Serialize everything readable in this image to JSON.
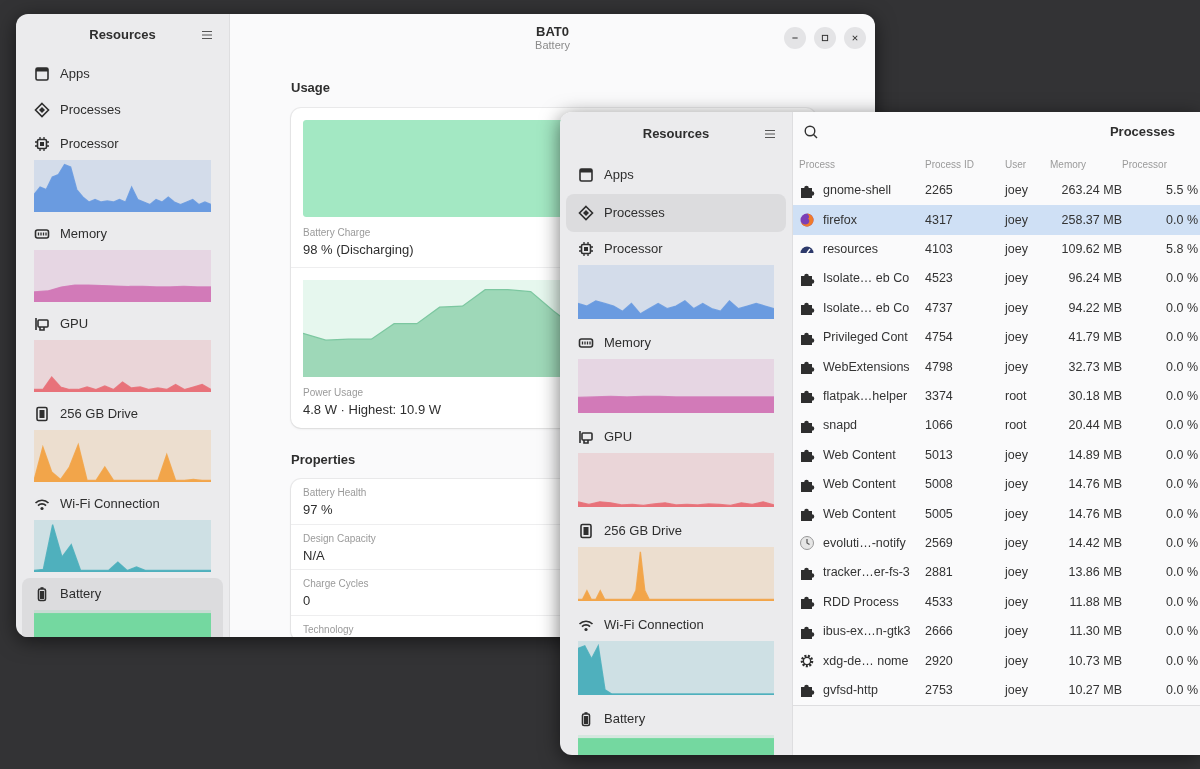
{
  "battery_window": {
    "title": "BAT0",
    "subtitle": "Battery",
    "sidebar": {
      "title": "Resources",
      "items": [
        {
          "label": "Apps",
          "kind": "link",
          "selected": false
        },
        {
          "label": "Processes",
          "kind": "link",
          "selected": false
        },
        {
          "label": "Processor",
          "kind": "graph",
          "selected": false,
          "color": "#6a9be0"
        },
        {
          "label": "Memory",
          "kind": "graph",
          "selected": false,
          "color": "#d27ab8"
        },
        {
          "label": "GPU",
          "kind": "graph",
          "selected": false,
          "color": "#e8727a"
        },
        {
          "label": "256 GB Drive",
          "kind": "graph",
          "selected": false,
          "color": "#f2a54a"
        },
        {
          "label": "Wi-Fi Connection",
          "kind": "graph",
          "selected": false,
          "color": "#4fb0bd"
        },
        {
          "label": "Battery",
          "kind": "graph",
          "selected": true,
          "color": "#74d8a0"
        }
      ]
    },
    "usage": {
      "heading": "Usage",
      "charge": {
        "label": "Battery Charge",
        "value": "98 % (Discharging)",
        "level": 0.98
      },
      "power": {
        "label": "Power Usage",
        "value": "4.8 W · Highest: 10.9 W"
      }
    },
    "properties": {
      "heading": "Properties",
      "rows": [
        {
          "label": "Battery Health",
          "value": "97 %"
        },
        {
          "label": "Design Capacity",
          "value": "N/A"
        },
        {
          "label": "Charge Cycles",
          "value": "0"
        },
        {
          "label": "Technology"
        }
      ]
    }
  },
  "processes_window": {
    "title": "Processes",
    "sidebar": {
      "title": "Resources",
      "items": [
        {
          "label": "Apps",
          "kind": "link",
          "selected": false
        },
        {
          "label": "Processes",
          "kind": "link",
          "selected": true
        },
        {
          "label": "Processor",
          "kind": "graph",
          "selected": false,
          "color": "#6a9be0"
        },
        {
          "label": "Memory",
          "kind": "graph",
          "selected": false,
          "color": "#d27ab8"
        },
        {
          "label": "GPU",
          "kind": "graph",
          "selected": false,
          "color": "#e8727a"
        },
        {
          "label": "256 GB Drive",
          "kind": "graph",
          "selected": false,
          "color": "#f2a54a"
        },
        {
          "label": "Wi-Fi Connection",
          "kind": "graph",
          "selected": false,
          "color": "#4fb0bd"
        },
        {
          "label": "Battery",
          "kind": "graph",
          "selected": false,
          "color": "#74d8a0"
        }
      ]
    },
    "table": {
      "columns": [
        "Process",
        "Process ID",
        "User",
        "Memory",
        "Processor"
      ],
      "rows": [
        {
          "cells": [
            "gnome-shell",
            "2265",
            "joey",
            "263.24 MB",
            "5.5 %"
          ],
          "selected": false
        },
        {
          "cells": [
            "firefox",
            "4317",
            "joey",
            "258.37 MB",
            "0.0 %"
          ],
          "selected": true
        },
        {
          "cells": [
            "resources",
            "4103",
            "joey",
            "109.62 MB",
            "5.8 %"
          ],
          "selected": false
        },
        {
          "cells": [
            "Isolate… eb Co",
            "4523",
            "joey",
            "96.24 MB",
            "0.0 %"
          ],
          "selected": false
        },
        {
          "cells": [
            "Isolate… eb Co",
            "4737",
            "joey",
            "94.22 MB",
            "0.0 %"
          ],
          "selected": false
        },
        {
          "cells": [
            "Privileged Cont",
            "4754",
            "joey",
            "41.79 MB",
            "0.0 %"
          ],
          "selected": false
        },
        {
          "cells": [
            "WebExtensions",
            "4798",
            "joey",
            "32.73 MB",
            "0.0 %"
          ],
          "selected": false
        },
        {
          "cells": [
            "flatpak…helper",
            "3374",
            "root",
            "30.18 MB",
            "0.0 %"
          ],
          "selected": false
        },
        {
          "cells": [
            "snapd",
            "1066",
            "root",
            "20.44 MB",
            "0.0 %"
          ],
          "selected": false
        },
        {
          "cells": [
            "Web Content",
            "5013",
            "joey",
            "14.89 MB",
            "0.0 %"
          ],
          "selected": false
        },
        {
          "cells": [
            "Web Content",
            "5008",
            "joey",
            "14.76 MB",
            "0.0 %"
          ],
          "selected": false
        },
        {
          "cells": [
            "Web Content",
            "5005",
            "joey",
            "14.76 MB",
            "0.0 %"
          ],
          "selected": false
        },
        {
          "cells": [
            "evoluti…-notify",
            "2569",
            "joey",
            "14.42 MB",
            "0.0 %"
          ],
          "selected": false
        },
        {
          "cells": [
            "tracker…er-fs-3",
            "2881",
            "joey",
            "13.86 MB",
            "0.0 %"
          ],
          "selected": false
        },
        {
          "cells": [
            "RDD Process",
            "4533",
            "joey",
            "11.88 MB",
            "0.0 %"
          ],
          "selected": false
        },
        {
          "cells": [
            "ibus-ex…n-gtk3",
            "2666",
            "joey",
            "11.30 MB",
            "0.0 %"
          ],
          "selected": false
        },
        {
          "cells": [
            "xdg-de… nome",
            "2920",
            "joey",
            "10.73 MB",
            "0.0 %"
          ],
          "selected": false
        },
        {
          "cells": [
            "gvfsd-http",
            "2753",
            "joey",
            "10.27 MB",
            "0.0 %"
          ],
          "selected": false
        }
      ]
    }
  }
}
